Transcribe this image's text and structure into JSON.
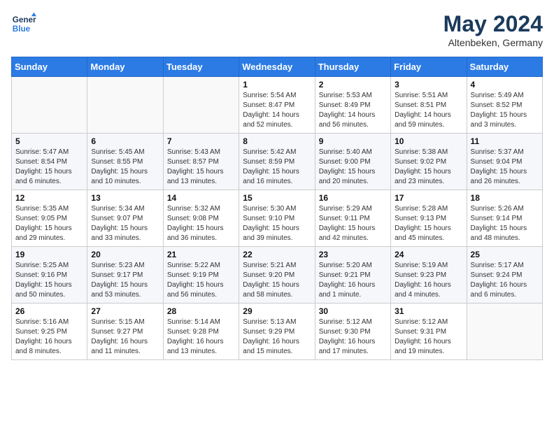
{
  "header": {
    "logo_line1": "General",
    "logo_line2": "Blue",
    "title": "May 2024",
    "subtitle": "Altenbeken, Germany"
  },
  "calendar": {
    "weekdays": [
      "Sunday",
      "Monday",
      "Tuesday",
      "Wednesday",
      "Thursday",
      "Friday",
      "Saturday"
    ],
    "weeks": [
      [
        {
          "day": "",
          "info": ""
        },
        {
          "day": "",
          "info": ""
        },
        {
          "day": "",
          "info": ""
        },
        {
          "day": "1",
          "info": "Sunrise: 5:54 AM\nSunset: 8:47 PM\nDaylight: 14 hours and 52 minutes."
        },
        {
          "day": "2",
          "info": "Sunrise: 5:53 AM\nSunset: 8:49 PM\nDaylight: 14 hours and 56 minutes."
        },
        {
          "day": "3",
          "info": "Sunrise: 5:51 AM\nSunset: 8:51 PM\nDaylight: 14 hours and 59 minutes."
        },
        {
          "day": "4",
          "info": "Sunrise: 5:49 AM\nSunset: 8:52 PM\nDaylight: 15 hours and 3 minutes."
        }
      ],
      [
        {
          "day": "5",
          "info": "Sunrise: 5:47 AM\nSunset: 8:54 PM\nDaylight: 15 hours and 6 minutes."
        },
        {
          "day": "6",
          "info": "Sunrise: 5:45 AM\nSunset: 8:55 PM\nDaylight: 15 hours and 10 minutes."
        },
        {
          "day": "7",
          "info": "Sunrise: 5:43 AM\nSunset: 8:57 PM\nDaylight: 15 hours and 13 minutes."
        },
        {
          "day": "8",
          "info": "Sunrise: 5:42 AM\nSunset: 8:59 PM\nDaylight: 15 hours and 16 minutes."
        },
        {
          "day": "9",
          "info": "Sunrise: 5:40 AM\nSunset: 9:00 PM\nDaylight: 15 hours and 20 minutes."
        },
        {
          "day": "10",
          "info": "Sunrise: 5:38 AM\nSunset: 9:02 PM\nDaylight: 15 hours and 23 minutes."
        },
        {
          "day": "11",
          "info": "Sunrise: 5:37 AM\nSunset: 9:04 PM\nDaylight: 15 hours and 26 minutes."
        }
      ],
      [
        {
          "day": "12",
          "info": "Sunrise: 5:35 AM\nSunset: 9:05 PM\nDaylight: 15 hours and 29 minutes."
        },
        {
          "day": "13",
          "info": "Sunrise: 5:34 AM\nSunset: 9:07 PM\nDaylight: 15 hours and 33 minutes."
        },
        {
          "day": "14",
          "info": "Sunrise: 5:32 AM\nSunset: 9:08 PM\nDaylight: 15 hours and 36 minutes."
        },
        {
          "day": "15",
          "info": "Sunrise: 5:30 AM\nSunset: 9:10 PM\nDaylight: 15 hours and 39 minutes."
        },
        {
          "day": "16",
          "info": "Sunrise: 5:29 AM\nSunset: 9:11 PM\nDaylight: 15 hours and 42 minutes."
        },
        {
          "day": "17",
          "info": "Sunrise: 5:28 AM\nSunset: 9:13 PM\nDaylight: 15 hours and 45 minutes."
        },
        {
          "day": "18",
          "info": "Sunrise: 5:26 AM\nSunset: 9:14 PM\nDaylight: 15 hours and 48 minutes."
        }
      ],
      [
        {
          "day": "19",
          "info": "Sunrise: 5:25 AM\nSunset: 9:16 PM\nDaylight: 15 hours and 50 minutes."
        },
        {
          "day": "20",
          "info": "Sunrise: 5:23 AM\nSunset: 9:17 PM\nDaylight: 15 hours and 53 minutes."
        },
        {
          "day": "21",
          "info": "Sunrise: 5:22 AM\nSunset: 9:19 PM\nDaylight: 15 hours and 56 minutes."
        },
        {
          "day": "22",
          "info": "Sunrise: 5:21 AM\nSunset: 9:20 PM\nDaylight: 15 hours and 58 minutes."
        },
        {
          "day": "23",
          "info": "Sunrise: 5:20 AM\nSunset: 9:21 PM\nDaylight: 16 hours and 1 minute."
        },
        {
          "day": "24",
          "info": "Sunrise: 5:19 AM\nSunset: 9:23 PM\nDaylight: 16 hours and 4 minutes."
        },
        {
          "day": "25",
          "info": "Sunrise: 5:17 AM\nSunset: 9:24 PM\nDaylight: 16 hours and 6 minutes."
        }
      ],
      [
        {
          "day": "26",
          "info": "Sunrise: 5:16 AM\nSunset: 9:25 PM\nDaylight: 16 hours and 8 minutes."
        },
        {
          "day": "27",
          "info": "Sunrise: 5:15 AM\nSunset: 9:27 PM\nDaylight: 16 hours and 11 minutes."
        },
        {
          "day": "28",
          "info": "Sunrise: 5:14 AM\nSunset: 9:28 PM\nDaylight: 16 hours and 13 minutes."
        },
        {
          "day": "29",
          "info": "Sunrise: 5:13 AM\nSunset: 9:29 PM\nDaylight: 16 hours and 15 minutes."
        },
        {
          "day": "30",
          "info": "Sunrise: 5:12 AM\nSunset: 9:30 PM\nDaylight: 16 hours and 17 minutes."
        },
        {
          "day": "31",
          "info": "Sunrise: 5:12 AM\nSunset: 9:31 PM\nDaylight: 16 hours and 19 minutes."
        },
        {
          "day": "",
          "info": ""
        }
      ]
    ]
  }
}
